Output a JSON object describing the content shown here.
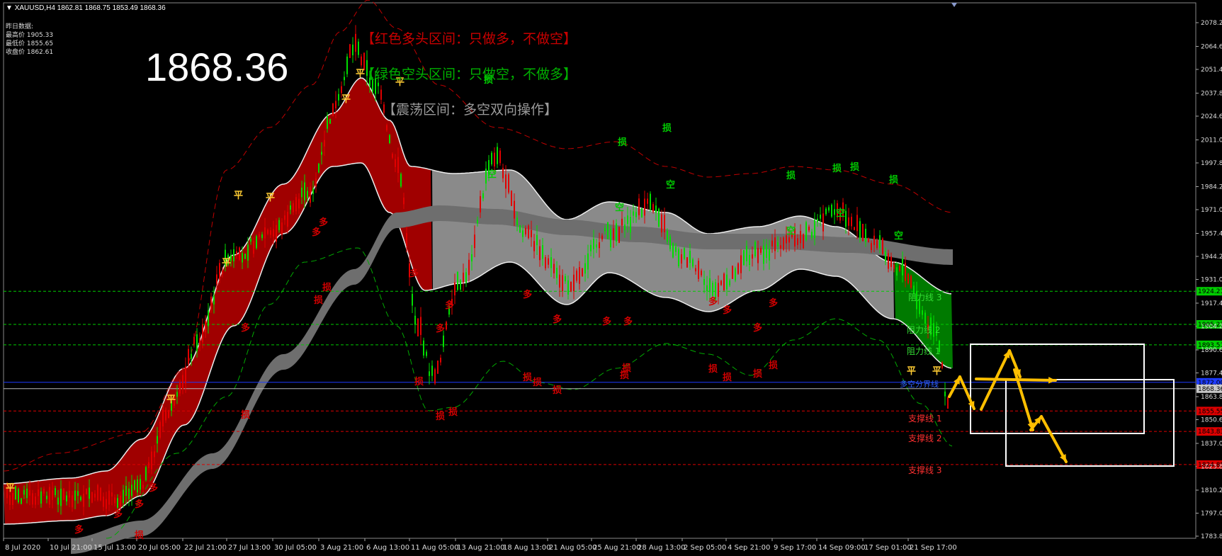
{
  "header": {
    "symbol": "XAUUSD,H4",
    "ohlc": "1862.81 1868.75 1853.49 1868.36"
  },
  "yesterday": {
    "title": "昨日数据:",
    "high": "最高价 1905.33",
    "low": "最低价 1855.65",
    "close": "收盘价 1862.61"
  },
  "current_price": "1868.36",
  "zones": {
    "red": "【红色多头区间：只做多，不做空】",
    "green": "【绿色空头区间：只做空，不做多】",
    "gray": "【震荡区间：多空双向操作】"
  },
  "price_axis": [
    "2078.20",
    "2064.60",
    "2051.40",
    "2037.80",
    "2024.60",
    "2011.00",
    "1997.80",
    "1984.20",
    "1971.00",
    "1957.40",
    "1944.20",
    "1931.00",
    "1917.40",
    "1904.20",
    "1890.60",
    "1877.40",
    "1863.80",
    "1850.60",
    "1837.00",
    "1823.80",
    "1810.20",
    "1797.00",
    "1783.80"
  ],
  "price_tags": [
    {
      "label": "1924.21",
      "value": 1924.21,
      "color": "#00cc00"
    },
    {
      "label": "1905.23",
      "value": 1905.23,
      "color": "#00cc00"
    },
    {
      "label": "1893.51",
      "value": 1893.51,
      "color": "#00cc00"
    },
    {
      "label": "1872.00",
      "value": 1872.0,
      "color": "#1e3cff"
    },
    {
      "label": "1868.36",
      "value": 1868.36,
      "color": "#c8c8c8"
    },
    {
      "label": "1855.55",
      "value": 1855.55,
      "color": "#dd0000"
    },
    {
      "label": "1843.83",
      "value": 1843.83,
      "color": "#dd0000"
    },
    {
      "label": "1824.85",
      "value": 1824.85,
      "color": "#dd0000"
    }
  ],
  "time_axis": [
    "8 Jul 2020",
    "10 Jul 21:00",
    "15 Jul 13:00",
    "20 Jul 05:00",
    "22 Jul 21:00",
    "27 Jul 13:00",
    "30 Jul 05:00",
    "3 Aug 21:00",
    "6 Aug 13:00",
    "11 Aug 05:00",
    "13 Aug 21:00",
    "18 Aug 13:00",
    "21 Aug 05:00",
    "25 Aug 21:00",
    "28 Aug 13:00",
    "2 Sep 05:00",
    "4 Sep 21:00",
    "9 Sep 17:00",
    "14 Sep 09:00",
    "17 Sep 01:00",
    "21 Sep 17:00"
  ],
  "levels": {
    "resist1": "阻力线 1",
    "resist2": "阻力线 2",
    "resist3": "阻力线 3",
    "balance": "多空分界线",
    "support1": "支撑线 1",
    "support2": "支撑线 2",
    "support3": "支撑线 3"
  },
  "markers": {
    "long": "多",
    "short": "空",
    "flat": "平",
    "stop": "损"
  },
  "colors": {
    "bull": "#c00000",
    "bear": "#00c800",
    "range": "#8c8c8c",
    "arrow": "#ffbf00"
  }
}
